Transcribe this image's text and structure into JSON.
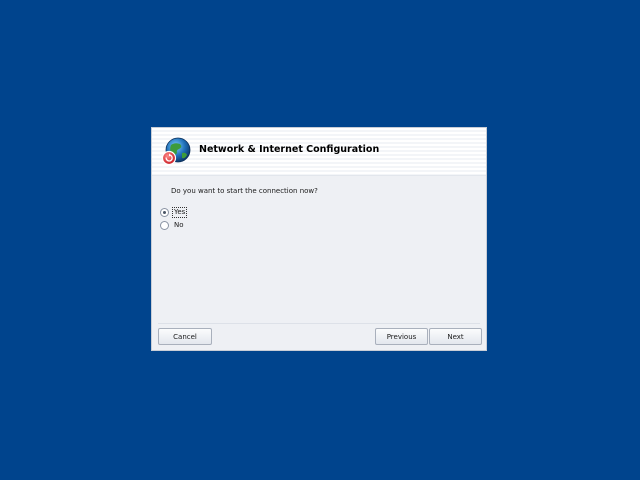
{
  "dialog": {
    "title": "Network & Internet Configuration",
    "icon": "network-globe-icon",
    "question": "Do you want to start the connection now?",
    "options": [
      {
        "label": "Yes",
        "selected": true
      },
      {
        "label": "No",
        "selected": false
      }
    ],
    "buttons": {
      "cancel": "Cancel",
      "previous": "Previous",
      "next": "Next"
    }
  },
  "colors": {
    "desktop_background": "#00448d",
    "dialog_background": "#eef0f4",
    "header_background": "#ffffff"
  }
}
